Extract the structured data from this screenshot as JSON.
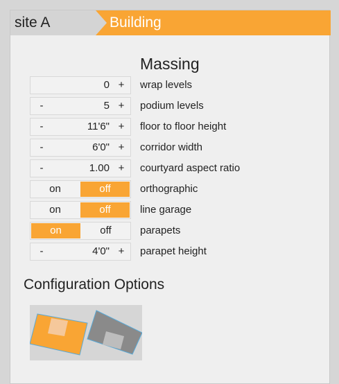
{
  "breadcrumb": {
    "site_label": "site A",
    "building_label": "Building"
  },
  "massing": {
    "title": "Massing",
    "rows": [
      {
        "kind": "stepper",
        "minus": "",
        "value": "0",
        "plus": "+",
        "label": "wrap levels"
      },
      {
        "kind": "stepper",
        "minus": "-",
        "value": "5",
        "plus": "+",
        "label": "podium levels"
      },
      {
        "kind": "stepper",
        "minus": "-",
        "value": "11'6\"",
        "plus": "+",
        "label": "floor to floor height"
      },
      {
        "kind": "stepper",
        "minus": "-",
        "value": "6'0\"",
        "plus": "+",
        "label": "corridor width"
      },
      {
        "kind": "stepper",
        "minus": "-",
        "value": "1.00",
        "plus": "+",
        "label": "courtyard aspect ratio"
      },
      {
        "kind": "toggle",
        "on": "on",
        "off": "off",
        "selected": "off",
        "label": "orthographic"
      },
      {
        "kind": "toggle",
        "on": "on",
        "off": "off",
        "selected": "off",
        "label": "line garage"
      },
      {
        "kind": "toggle",
        "on": "on",
        "off": "off",
        "selected": "on",
        "label": "parapets"
      },
      {
        "kind": "stepper",
        "minus": "-",
        "value": "4'0\"",
        "plus": "+",
        "label": "parapet height"
      }
    ]
  },
  "configuration": {
    "title": "Configuration Options",
    "options": [
      {
        "icon": "courtyard-building-orange-icon"
      },
      {
        "icon": "courtyard-building-gray-icon"
      }
    ]
  },
  "colors": {
    "accent": "#f9a534",
    "panel": "#efefef",
    "tab_inactive": "#d4d4d4",
    "option_border": "#5aa9d6"
  }
}
